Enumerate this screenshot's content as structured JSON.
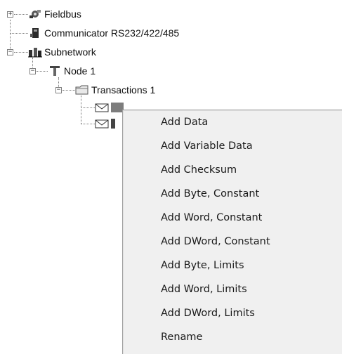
{
  "tree": {
    "fieldbus": {
      "label": "Fieldbus",
      "expander": "+",
      "icon": "fieldbus-icon"
    },
    "communicator": {
      "label": "Communicator RS232/422/485",
      "icon": "communicator-icon"
    },
    "subnetwork": {
      "label": "Subnetwork",
      "expander": "−",
      "icon": "subnetwork-icon"
    },
    "node1": {
      "label": "Node 1",
      "expander": "−",
      "icon": "node-icon"
    },
    "transactions1": {
      "label": "Transactions 1",
      "expander": "−",
      "icon": "folder-icon"
    },
    "item1": {
      "label": "",
      "icon": "envelope-icon"
    },
    "item2": {
      "label": "",
      "icon": "envelope-icon"
    }
  },
  "context_menu": {
    "items": [
      "Add Data",
      "Add Variable Data",
      "Add Checksum",
      "Add Byte, Constant",
      "Add Word, Constant",
      "Add DWord, Constant",
      "Add Byte, Limits",
      "Add Word, Limits",
      "Add DWord, Limits",
      "Rename"
    ]
  }
}
